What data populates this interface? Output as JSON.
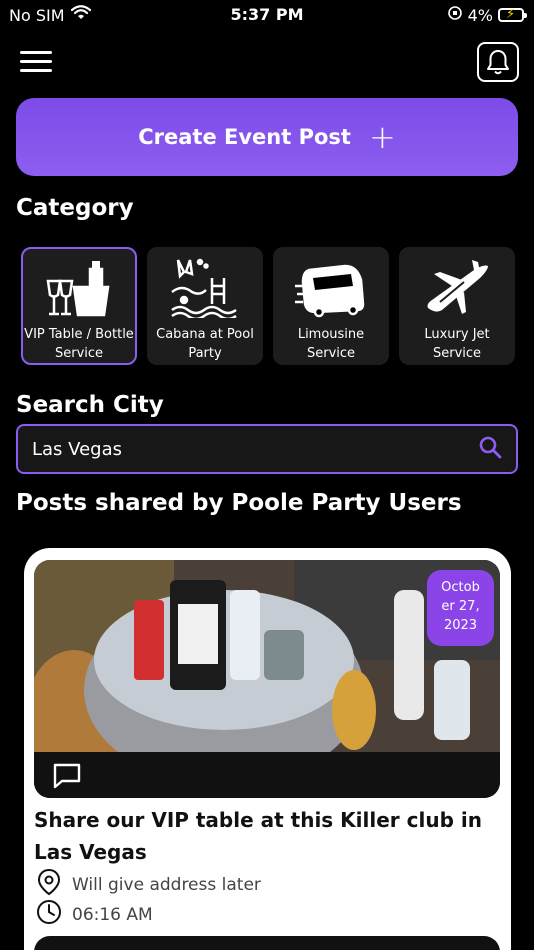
{
  "status_bar": {
    "carrier": "No SIM",
    "time": "5:37 PM",
    "battery": "4%"
  },
  "header": {
    "menu_icon": "hamburger-menu-icon",
    "notification_icon": "bell-icon"
  },
  "create_event": {
    "label": "Create Event Post",
    "icon": "plus-icon",
    "color": "#8053ec"
  },
  "category": {
    "title": "Category",
    "items": [
      {
        "label": "VIP Table / Bottle Service",
        "icon": "bottle-bucket-icon",
        "selected": true
      },
      {
        "label": "Cabana at Pool Party",
        "icon": "pool-cabana-icon",
        "selected": false
      },
      {
        "label": "Limousine Service",
        "icon": "limousine-icon",
        "selected": false
      },
      {
        "label": "Luxury Jet Service",
        "icon": "jet-icon",
        "selected": false
      }
    ]
  },
  "search": {
    "title": "Search City",
    "value": "Las Vegas",
    "icon": "search-icon",
    "accent": "#8a5cf0"
  },
  "posts": {
    "title": "Posts shared by Poole Party Users",
    "items": [
      {
        "date": "Octob er 27, 2023",
        "date_lines": [
          "Octob",
          "er 27,",
          "2023"
        ],
        "title": "Share our VIP table at this Killer club in Las Vegas",
        "address": "Will give address later",
        "time": "06:16 AM"
      }
    ]
  }
}
